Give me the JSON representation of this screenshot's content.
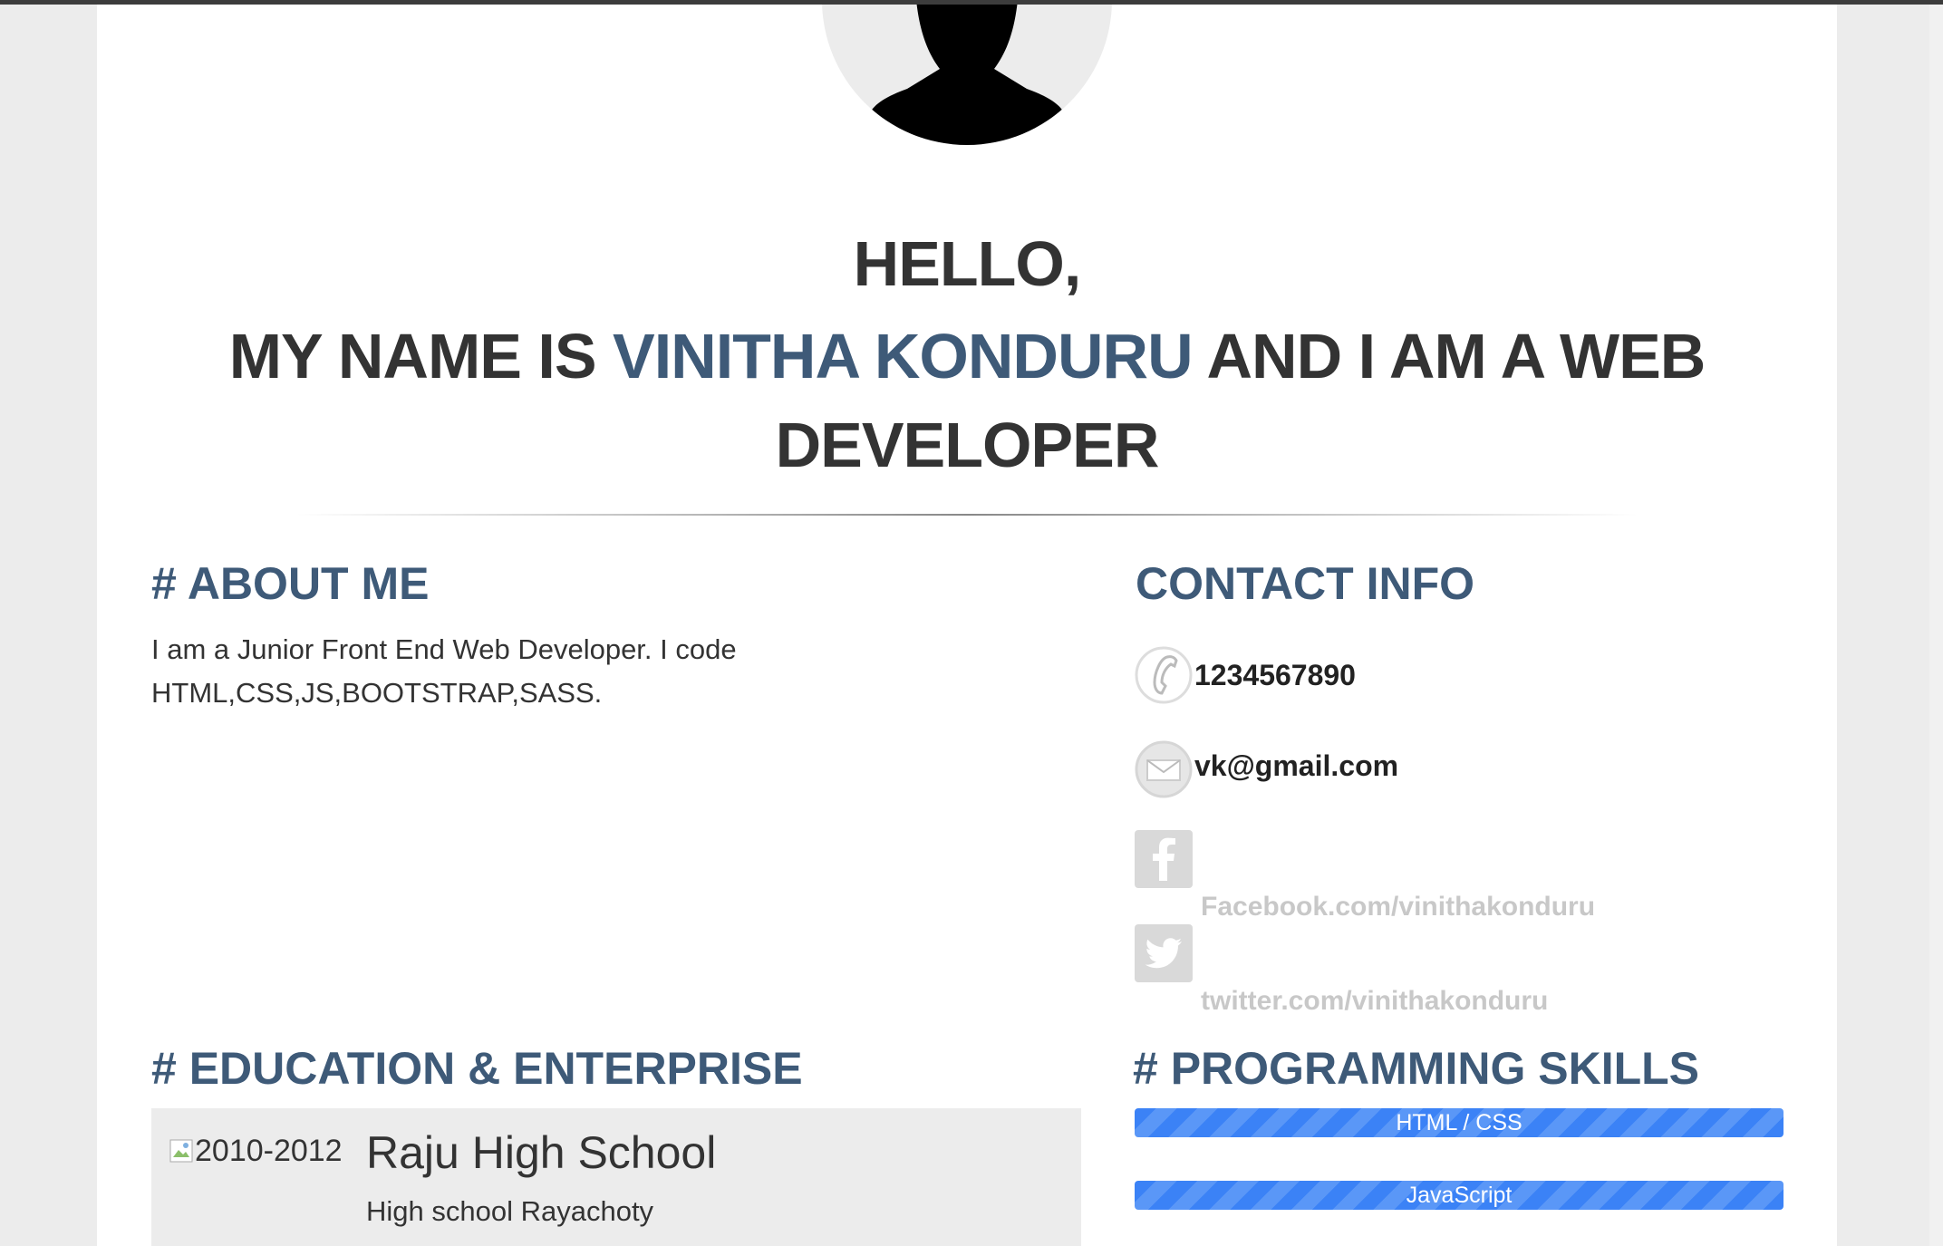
{
  "hero": {
    "greeting": "HELLO,",
    "intro_prefix": "MY NAME IS",
    "name": "VINITHA KONDURU",
    "intro_suffix": "AND I AM A WEB",
    "role_line2": "DEVELOPER"
  },
  "about": {
    "title": "# ABOUT ME",
    "text": "I am a Junior Front End Web Developer. I code HTML,CSS,JS,BOOTSTRAP,SASS."
  },
  "contact": {
    "title": "CONTACT INFO",
    "phone": "1234567890",
    "email": "vk@gmail.com",
    "facebook": "Facebook.com/vinithakonduru",
    "twitter": "twitter.com/vinithakonduru",
    "icons": [
      "phone-icon",
      "mail-icon",
      "facebook-icon",
      "twitter-icon"
    ]
  },
  "education": {
    "title": "# EDUCATION & ENTERPRISE",
    "items": [
      {
        "year": "2010-2012",
        "school": "Raju High School",
        "place": "High school Rayachoty"
      }
    ]
  },
  "skills": {
    "title": "# PROGRAMMING SKILLS",
    "items": [
      {
        "label": "HTML / CSS",
        "level": 1.0
      },
      {
        "label": "JavaScript",
        "level": 1.0
      }
    ]
  },
  "colors": {
    "accent": "#3e5a78",
    "text": "#333333",
    "skill_bar": "#3b82f6",
    "muted_link": "#c8c8c8",
    "panel": "#ececec"
  }
}
